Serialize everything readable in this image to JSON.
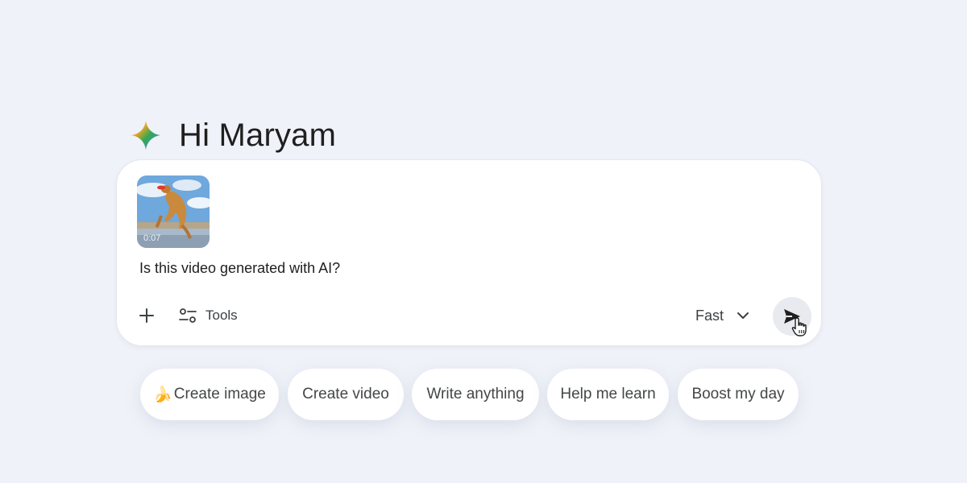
{
  "greeting": {
    "text": "Hi Maryam",
    "icon": "gemini-spark-icon"
  },
  "composer": {
    "attachment": {
      "type": "video",
      "duration": "0:07",
      "icon": "video-thumbnail"
    },
    "prompt_text": "Is this video generated with AI?",
    "add_icon": "plus-icon",
    "tools_label": "Tools",
    "tools_icon": "tools-sliders-icon",
    "mode_label": "Fast",
    "mode_icon": "chevron-down-icon",
    "send_icon": "send-icon",
    "cursor_icon": "hand-pointer-icon"
  },
  "suggestions": [
    {
      "emoji": "🍌",
      "label": "Create image"
    },
    {
      "label": "Create video"
    },
    {
      "label": "Write anything"
    },
    {
      "label": "Help me learn"
    },
    {
      "label": "Boost my day"
    }
  ],
  "colors": {
    "background": "#eff2f8",
    "card": "#ffffff",
    "text": "#1f1f1f",
    "secondary_text": "#444746",
    "send_button_bg": "#e8eaf0"
  }
}
